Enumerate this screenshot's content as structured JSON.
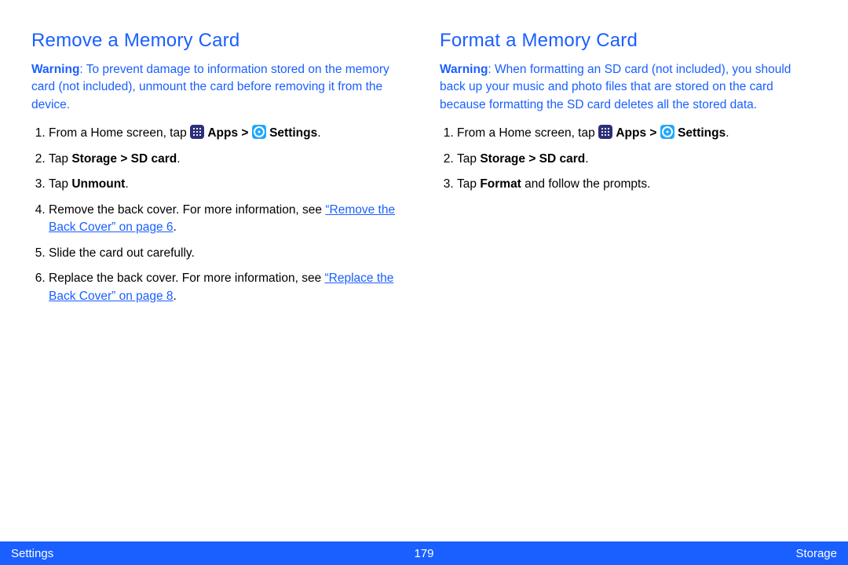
{
  "left": {
    "heading": "Remove a Memory Card",
    "warning_label": "Warning",
    "warning_text": ": To prevent damage to information stored on the memory card (not included), unmount the card before removing it from the device.",
    "steps": {
      "s1_pre": "From a Home screen, tap ",
      "s1_apps": "Apps > ",
      "s1_settings": "Settings",
      "s1_post": ".",
      "s2_pre": "Tap ",
      "s2_bold": "Storage > SD card",
      "s2_post": ".",
      "s3_pre": "Tap ",
      "s3_bold": "Unmount",
      "s3_post": ".",
      "s4_pre": "Remove the back cover. For more information, see ",
      "s4_link": "“Remove the Back Cover” on page 6",
      "s4_post": ".",
      "s5": "Slide the card out carefully.",
      "s6_pre": "Replace the back cover. For more information, see ",
      "s6_link": "“Replace the Back Cover” on page 8",
      "s6_post": "."
    }
  },
  "right": {
    "heading": "Format a Memory Card",
    "warning_label": "Warning",
    "warning_text": ": When formatting an SD card (not included), you should back up your music and photo files that are stored on the card because formatting the SD card deletes all the stored data.",
    "steps": {
      "s1_pre": "From a Home screen, tap ",
      "s1_apps": "Apps > ",
      "s1_settings": "Settings",
      "s1_post": ".",
      "s2_pre": "Tap ",
      "s2_bold": "Storage > SD card",
      "s2_post": ".",
      "s3_pre": "Tap ",
      "s3_bold": "Format",
      "s3_post": " and follow the prompts."
    }
  },
  "footer": {
    "left": "Settings",
    "center": "179",
    "right": "Storage"
  }
}
